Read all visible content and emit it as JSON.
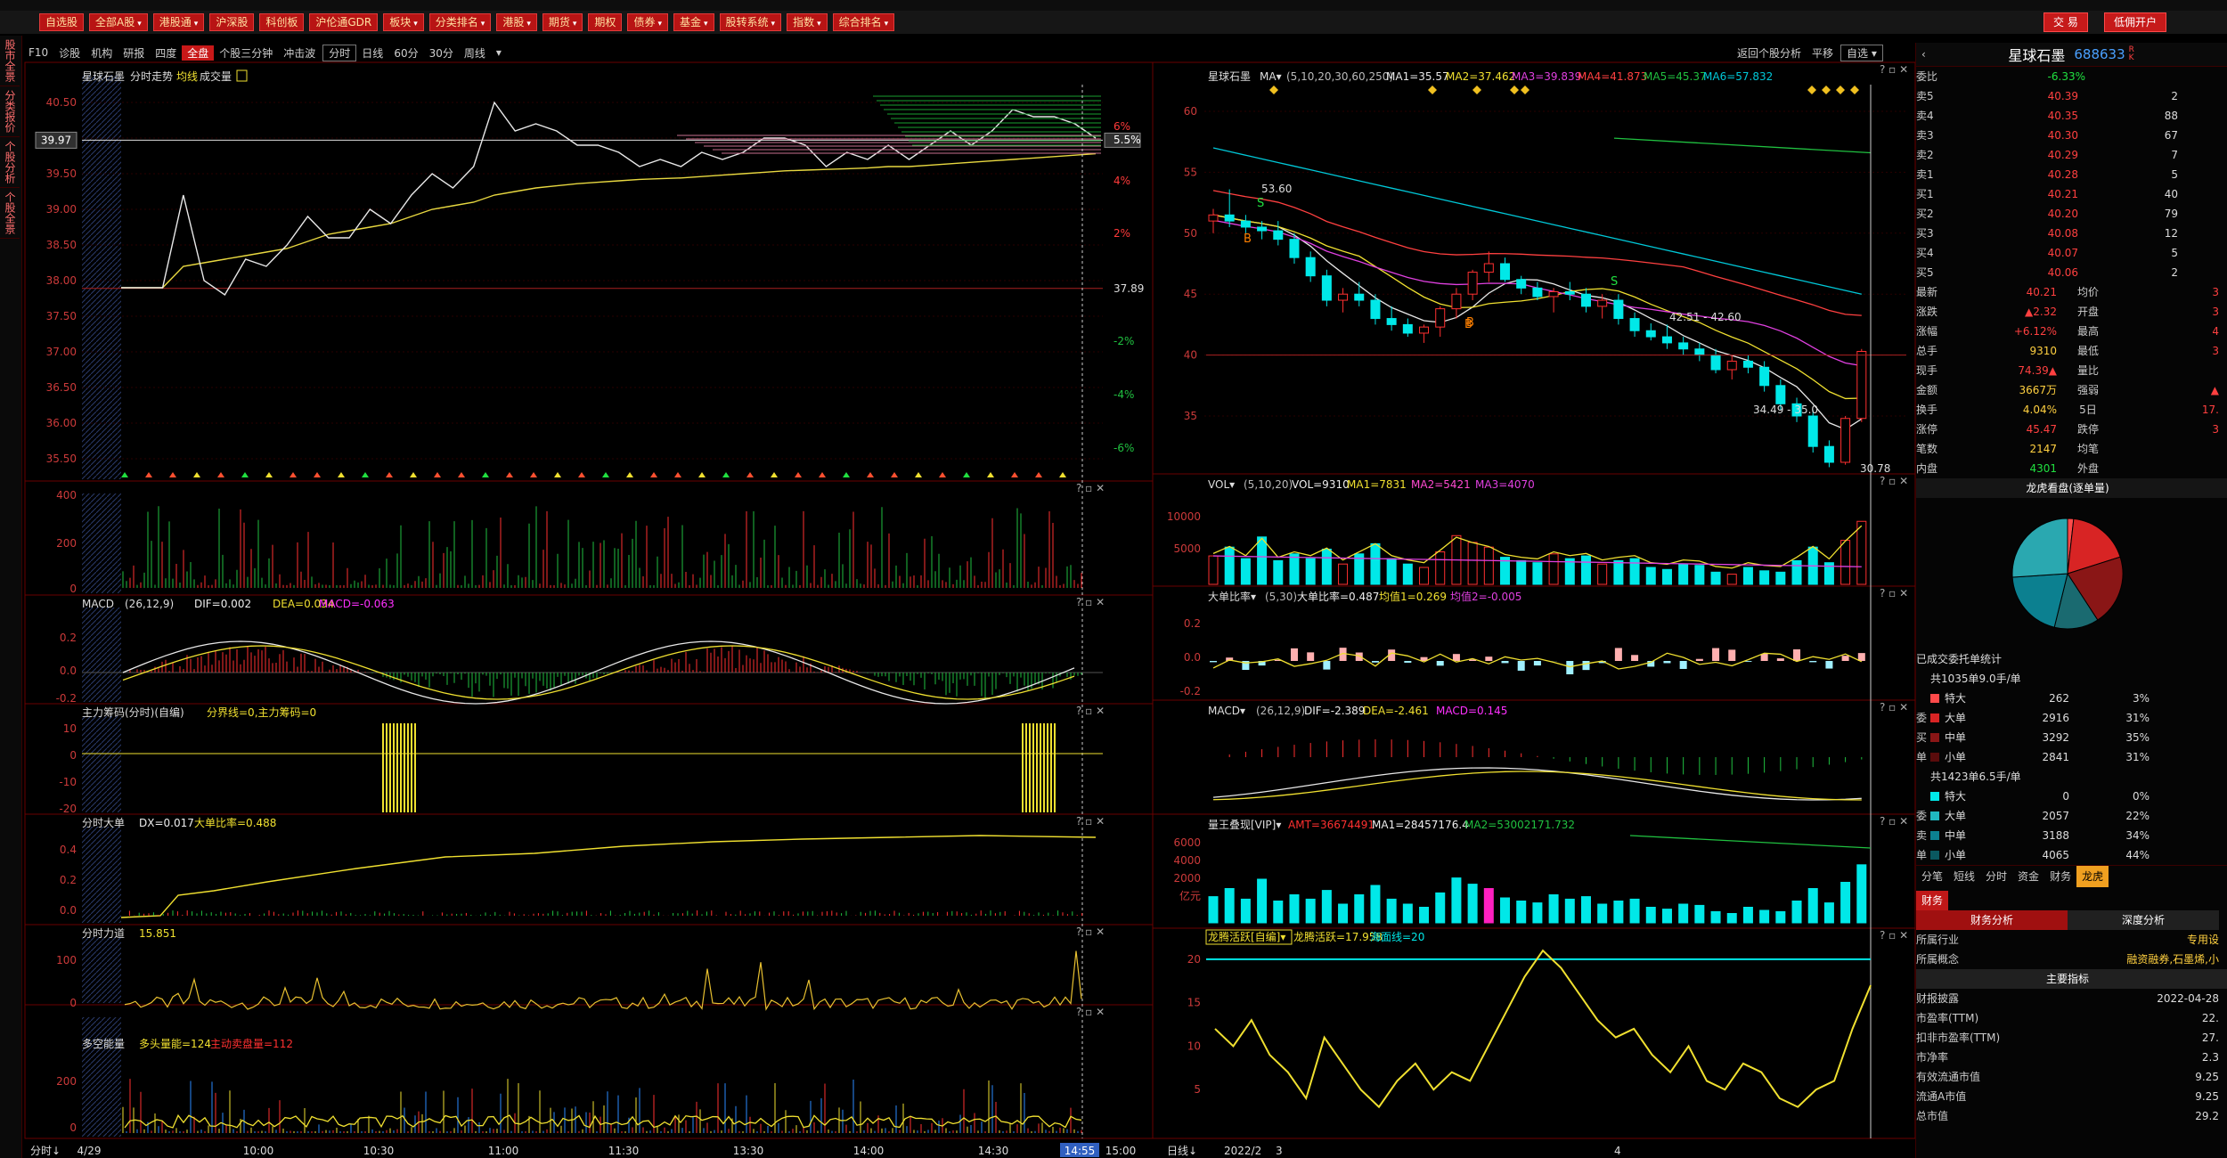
{
  "menu": [
    "自选股",
    "全部A股",
    "港股通",
    "沪深股",
    "科创板",
    "沪伦通GDR",
    "板块",
    "分类排名",
    "港股",
    "期货",
    "期权",
    "债券",
    "基金",
    "股转系统",
    "指数",
    "综合排名"
  ],
  "menu_arrows": [
    false,
    true,
    true,
    false,
    false,
    false,
    true,
    true,
    true,
    true,
    false,
    true,
    true,
    true,
    true,
    true
  ],
  "right_buttons": {
    "trade": "交 易",
    "open_account": "低佣开户"
  },
  "sidebar": [
    "股市全景",
    "分类报价",
    "个股分析",
    "个股全景"
  ],
  "tabs": {
    "f10": "F10",
    "diag": "诊股",
    "inst": "机构",
    "research": "研报",
    "quadrant": "四度",
    "full": "全盘",
    "shares": "个股三分钟",
    "flush": "冲击波",
    "minute": "分时",
    "daily": "日线",
    "min60": "60分",
    "min30": "30分",
    "weekly": "周线"
  },
  "right_tabs": {
    "back": "返回个股分析",
    "flat": "平移",
    "self": "自选"
  },
  "left_chart": {
    "title": "星球石墨",
    "mode": "分时走势",
    "avg": "均线",
    "vol": "成交量",
    "price_ticks": [
      "40.50",
      "40.00",
      "39.50",
      "39.00",
      "38.50",
      "38.00",
      "37.50",
      "37.00",
      "36.50",
      "36.00",
      "35.50"
    ],
    "cursor_price": "39.97",
    "prev_close": "37.89",
    "pct_ticks": [
      "6%",
      "5.5%",
      "4%",
      "2%",
      "-2%",
      "-4%",
      "-6%"
    ],
    "vol_ticks": [
      "400",
      "200",
      "0"
    ],
    "time_labels": [
      "4/29",
      "10:00",
      "10:30",
      "11:00",
      "11:30",
      "13:30",
      "14:00",
      "14:30",
      "14:55",
      "15:00"
    ],
    "bottom_label": "分时",
    "macd": {
      "name": "MACD",
      "params": "(26,12,9)",
      "dif": "DIF=0.002",
      "dea": "DEA=0.034",
      "macd": "MACD=-0.063",
      "ticks": [
        "0.2",
        "0.0",
        "-0.2"
      ]
    },
    "main_force": {
      "name": "主力筹码(分时)(自编)",
      "text": "分界线=0,主力筹码=0",
      "ticks": [
        "10",
        "0",
        "-10",
        "-20"
      ]
    },
    "big_order": {
      "name": "分时大单",
      "dx": "DX=0.017",
      "ratio": "大单比率=0.488",
      "ticks": [
        "0.4",
        "0.2",
        "0.0"
      ]
    },
    "force": {
      "name": "分时力道",
      "val": "15.851",
      "ticks": [
        "100",
        "0"
      ]
    },
    "energy": {
      "name": "多空能量",
      "bull": "多头量能=124",
      "bear": "主动卖盘量=112",
      "ticks": [
        "200",
        "0"
      ]
    }
  },
  "right_chart": {
    "title": "星球石墨",
    "ma": "MA",
    "ma_params": "(5,10,20,30,60,250)",
    "ma_values": [
      "MA1=35.57",
      "MA2=37.462",
      "MA3=39.839",
      "MA4=41.873",
      "MA5=45.37",
      "MA6=57.832"
    ],
    "price_ticks": [
      "60",
      "55",
      "50",
      "45",
      "40",
      "35"
    ],
    "annotations": {
      "high": "53.60",
      "low": "30.78",
      "range1": "42.51 - 42.60",
      "range2": "34.49 - 35.0"
    },
    "vol": {
      "name": "VOL",
      "params": "(5,10,20)",
      "v": "VOL=9310",
      "ma1": "MA1=7831",
      "ma2": "MA2=5421",
      "ma3": "MA3=4070",
      "ticks": [
        "10000",
        "5000"
      ]
    },
    "bigratio": {
      "name": "大单比率",
      "params": "(5,30)",
      "a": "大单比率=0.487",
      "b": "均值1=0.269",
      "c": "均值2=-0.005",
      "ticks": [
        "0.2",
        "0.0",
        "-0.2"
      ]
    },
    "macd": {
      "name": "MACD",
      "params": "(26,12,9)",
      "dif": "DIF=-2.389",
      "dea": "DEA=-2.461",
      "macd": "MACD=0.145"
    },
    "amt": {
      "name": "量王叠现[VIP]",
      "amt": "AMT=36674491",
      "ma1": "MA1=28457176.4",
      "ma2": "MA2=53002171.732",
      "ticks": [
        "6000",
        "4000",
        "2000",
        "亿元"
      ]
    },
    "dragon": {
      "name": "龙腾活跃[自编]",
      "a": "龙腾活跃=17.958",
      "b": "海面线=20",
      "ticks": [
        "20",
        "15",
        "10",
        "5"
      ]
    },
    "date_labels": [
      "日线",
      "2022/2",
      "3",
      "4"
    ]
  },
  "chart_data": [
    {
      "type": "line",
      "title": "星球石墨 分时走势",
      "ylim": [
        35.3,
        40.7
      ],
      "price": [
        37.9,
        37.9,
        37.9,
        39.2,
        38.0,
        37.8,
        38.3,
        38.2,
        38.5,
        38.9,
        38.6,
        38.6,
        39.0,
        38.8,
        39.2,
        39.5,
        39.3,
        39.6,
        40.5,
        40.1,
        40.2,
        40.1,
        39.9,
        39.9,
        39.8,
        39.6,
        39.7,
        39.6,
        39.8,
        39.7,
        39.8,
        40.0,
        40.0,
        39.9,
        39.6,
        39.8,
        39.7,
        39.9,
        39.7,
        39.9,
        40.1,
        39.9,
        40.1,
        40.4,
        40.3,
        40.3,
        40.2,
        40.0
      ],
      "avg": [
        37.9,
        37.9,
        37.9,
        38.2,
        38.25,
        38.3,
        38.35,
        38.4,
        38.45,
        38.55,
        38.65,
        38.7,
        38.75,
        38.8,
        38.9,
        39.0,
        39.05,
        39.1,
        39.2,
        39.25,
        39.3,
        39.33,
        39.36,
        39.38,
        39.4,
        39.42,
        39.43,
        39.44,
        39.46,
        39.48,
        39.5,
        39.52,
        39.54,
        39.55,
        39.56,
        39.57,
        39.58,
        39.6,
        39.6,
        39.62,
        39.64,
        39.66,
        39.68,
        39.7,
        39.72,
        39.74,
        39.76,
        39.78
      ]
    },
    {
      "type": "bar",
      "title": "星球石墨 日线",
      "candles": [
        [
          51,
          52,
          50,
          51.5
        ],
        [
          51.5,
          53.6,
          50.5,
          51
        ],
        [
          51,
          51.5,
          50,
          50.5
        ],
        [
          50.5,
          51,
          49.5,
          50.2
        ],
        [
          50.2,
          51,
          49,
          49.5
        ],
        [
          49.5,
          50,
          47.5,
          48
        ],
        [
          48,
          48.5,
          46,
          46.5
        ],
        [
          46.5,
          47,
          44,
          44.5
        ],
        [
          44.5,
          45.5,
          43.5,
          45
        ],
        [
          45,
          46,
          44,
          44.5
        ],
        [
          44.5,
          45,
          42.5,
          43
        ],
        [
          43,
          44,
          42,
          42.5
        ],
        [
          42.5,
          43,
          41.5,
          41.8
        ],
        [
          41.8,
          42.5,
          41,
          42.3
        ],
        [
          42.3,
          44,
          41.5,
          43.8
        ],
        [
          43.8,
          45.5,
          43,
          45
        ],
        [
          45,
          47,
          44.5,
          46.8
        ],
        [
          46.8,
          48.5,
          46,
          47.5
        ],
        [
          47.5,
          48,
          46,
          46.2
        ],
        [
          46.2,
          46.5,
          45,
          45.5
        ],
        [
          45.5,
          46,
          44.5,
          44.8
        ],
        [
          44.8,
          45.5,
          43.5,
          45.2
        ],
        [
          45.2,
          46,
          44.5,
          45
        ],
        [
          45,
          45.5,
          43.5,
          44
        ],
        [
          44,
          45,
          43,
          44.5
        ],
        [
          44.5,
          45,
          42.5,
          43
        ],
        [
          43,
          43.5,
          41.5,
          42
        ],
        [
          42,
          42.6,
          41.2,
          41.5
        ],
        [
          41.5,
          42.5,
          40.5,
          41
        ],
        [
          41,
          41.5,
          40,
          40.5
        ],
        [
          40.5,
          41,
          39.5,
          40
        ],
        [
          40,
          40.5,
          38.5,
          38.8
        ],
        [
          38.8,
          40,
          38,
          39.5
        ],
        [
          39.5,
          40,
          38.5,
          39
        ],
        [
          39,
          39.5,
          37,
          37.5
        ],
        [
          37.5,
          38,
          35.5,
          36
        ],
        [
          36,
          36.5,
          34.5,
          35
        ],
        [
          35,
          35.5,
          32,
          32.5
        ],
        [
          32.5,
          33,
          30.8,
          31.2
        ],
        [
          31.2,
          35,
          31,
          34.8
        ],
        [
          34.8,
          40.5,
          34.5,
          40.3
        ]
      ],
      "volume": [
        4200,
        5500,
        3800,
        7000,
        3500,
        4500,
        3800,
        5200,
        3000,
        4500,
        6000,
        3800,
        3000,
        2500,
        4800,
        7200,
        6200,
        5500,
        4000,
        3500,
        3200,
        4500,
        3800,
        4200,
        3000,
        3500,
        3800,
        2500,
        2200,
        3000,
        2800,
        1800,
        1500,
        2500,
        2000,
        1800,
        3500,
        5500,
        3200,
        6500,
        9310
      ]
    },
    {
      "type": "line",
      "title": "龙腾活跃",
      "values": [
        12,
        10,
        13,
        9,
        7,
        4,
        11,
        8,
        5,
        3,
        6,
        8,
        5,
        7,
        6,
        10,
        14,
        18,
        21,
        19,
        16,
        13,
        11,
        12,
        9,
        7,
        10,
        6,
        5,
        8,
        7,
        4,
        3,
        5,
        6,
        12,
        17
      ]
    }
  ],
  "quote": {
    "title": "星球石墨",
    "code": "688633",
    "rk": "R K",
    "webi_label": "委比",
    "webi": "-6.33%",
    "asks": [
      [
        "卖5",
        "40.39",
        "2"
      ],
      [
        "卖4",
        "40.35",
        "88"
      ],
      [
        "卖3",
        "40.30",
        "67"
      ],
      [
        "卖2",
        "40.29",
        "7"
      ],
      [
        "卖1",
        "40.28",
        "5"
      ]
    ],
    "bids": [
      [
        "买1",
        "40.21",
        "40"
      ],
      [
        "买2",
        "40.20",
        "79"
      ],
      [
        "买3",
        "40.08",
        "12"
      ],
      [
        "买4",
        "40.07",
        "5"
      ],
      [
        "买5",
        "40.06",
        "2"
      ]
    ],
    "stats": [
      [
        "最新",
        "40.21",
        "均价",
        "3"
      ],
      [
        "涨跌",
        "▲2.32",
        "开盘",
        "3"
      ],
      [
        "涨幅",
        "+6.12%",
        "最高",
        "4"
      ],
      [
        "总手",
        "9310",
        "最低",
        "3"
      ],
      [
        "现手",
        "74.39▲",
        "量比",
        ""
      ],
      [
        "金额",
        "3667万",
        "强弱",
        "▲"
      ],
      [
        "换手",
        "4.04%",
        "5日",
        "17."
      ],
      [
        "涨停",
        "45.47",
        "跌停",
        "3"
      ],
      [
        "笔数",
        "2147",
        "均笔",
        ""
      ],
      [
        "内盘",
        "4301",
        "外盘",
        ""
      ]
    ],
    "dragon_title": "龙虎看盘(逐单量)",
    "order_title": "已成交委托单统计",
    "buy_summary": "共1035单9.0手/单",
    "buy_rows": [
      [
        "特大",
        "262",
        "3%"
      ],
      [
        "大单",
        "2916",
        "31%"
      ],
      [
        "中单",
        "3292",
        "35%"
      ],
      [
        "小单",
        "2841",
        "31%"
      ]
    ],
    "sell_summary": "共1423单6.5手/单",
    "sell_rows": [
      [
        "特大",
        "0",
        "0%"
      ],
      [
        "大单",
        "2057",
        "22%"
      ],
      [
        "中单",
        "3188",
        "34%"
      ],
      [
        "小单",
        "4065",
        "44%"
      ]
    ],
    "side_buy": [
      "委",
      "买",
      "单"
    ],
    "side_sell": [
      "委",
      "卖",
      "单"
    ],
    "bottom_tabs": [
      "分笔",
      "短线",
      "分时",
      "资金",
      "财务",
      "龙虎"
    ],
    "fin_tab": "财务",
    "fin_tabs": [
      "财务分析",
      "深度分析"
    ],
    "fin_rows": [
      [
        "所属行业",
        "专用设"
      ],
      [
        "所属概念",
        "融资融券,石墨烯,小"
      ]
    ],
    "main_index": "主要指标",
    "index_rows": [
      [
        "财报披露",
        "2022-04-28"
      ],
      [
        "市盈率(TTM)",
        "22."
      ],
      [
        "扣非市盈率(TTM)",
        "27."
      ],
      [
        "市净率",
        "2.3"
      ],
      [
        "有效流通市值",
        "9.25"
      ],
      [
        "流通A市值",
        "9.25"
      ],
      [
        "总市值",
        "29.2"
      ]
    ],
    "pie": [
      {
        "label": "买特大",
        "share": 3,
        "color": "#ff4a4a"
      },
      {
        "label": "买大单",
        "share": 31,
        "color": "#d82424"
      },
      {
        "label": "买中单",
        "share": 35,
        "color": "#8a1616"
      },
      {
        "label": "卖大单",
        "share": 22,
        "color": "#1a6a70"
      },
      {
        "label": "卖中单",
        "share": 34,
        "color": "#0c8090"
      },
      {
        "label": "卖小单",
        "share": 44,
        "color": "#2aa8b0"
      }
    ]
  },
  "colors": {
    "up": "#ff3030",
    "down": "#00e8e8",
    "ma_yellow": "#f0e030",
    "ma_white": "#e8e8e8",
    "ma_mag": "#e040e0",
    "ma_cyan": "#00c8d8",
    "ma_green": "#20c040",
    "border": "#6a0000"
  }
}
